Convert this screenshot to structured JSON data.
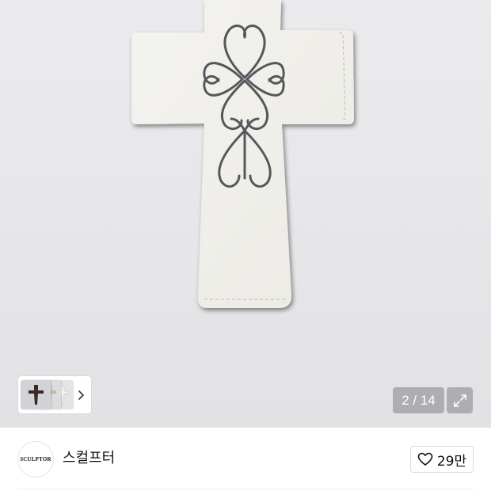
{
  "gallery": {
    "current_page": "2",
    "total_pages": "14",
    "page_indicator": "2 / 14",
    "thumbnails": [
      "cross-thumbnail-dark",
      "cross-thumbnail-beige",
      "cross-thumbnail-white"
    ],
    "next_icon": "chevron-right-icon",
    "expand_icon": "expand-icon"
  },
  "shop": {
    "logo_text": "SCULPTOR",
    "name": "스컬프터"
  },
  "like": {
    "icon": "heart-icon",
    "count": "29만"
  },
  "colors": {
    "image_background": "#e8e8eb",
    "cross_fill": "#f2f1ec",
    "filigree": "#5a5c60",
    "overlay": "#828287"
  }
}
